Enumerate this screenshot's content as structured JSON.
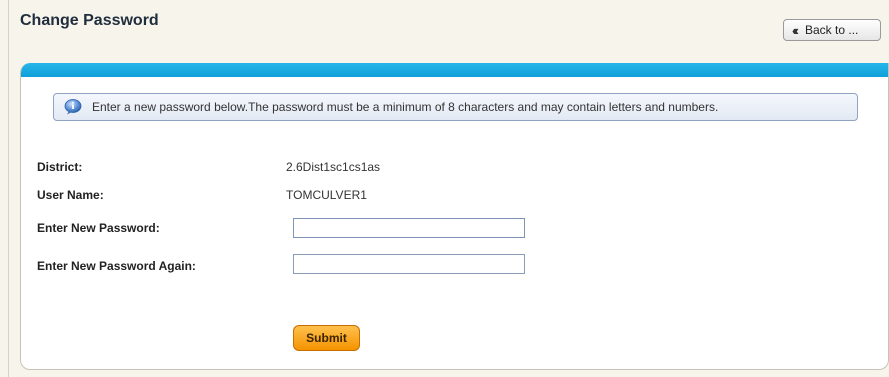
{
  "header": {
    "title": "Change Password",
    "back_label": "Back to ...",
    "back_icon": "double-chevron-left-icon"
  },
  "info": {
    "icon": "info-speech-bubble-icon",
    "text": "Enter a new password below.The password must be a minimum of 8 characters and may contain letters and numbers."
  },
  "form": {
    "district_label": "District:",
    "district_value": "2.6Dist1sc1cs1as",
    "username_label": "User Name:",
    "username_value": "TOMCULVER1",
    "new_password_label": "Enter New Password:",
    "new_password_value": "",
    "confirm_password_label": "Enter New Password Again:",
    "confirm_password_value": ""
  },
  "actions": {
    "submit_label": "Submit"
  },
  "colors": {
    "panel_bar": "#0d9fd8",
    "submit": "#f59300",
    "background": "#f7f4ec"
  }
}
